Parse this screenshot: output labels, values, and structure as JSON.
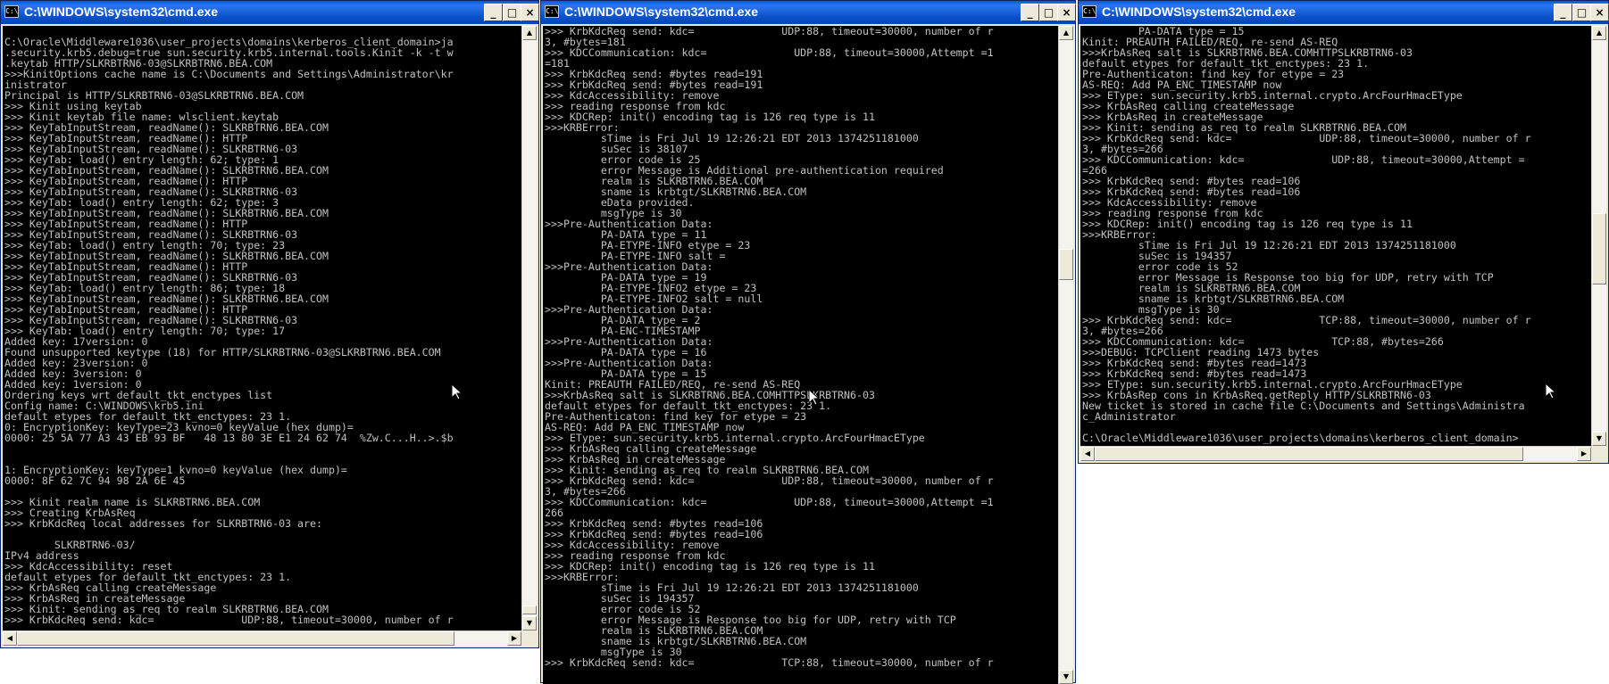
{
  "icon_names": [
    "cmd-icon",
    "minimize-icon",
    "maximize-icon",
    "close-icon",
    "scroll-up-icon",
    "scroll-down-icon",
    "scroll-left-icon",
    "scroll-right-icon",
    "mouse-cursor-icon"
  ],
  "colors": {
    "console_bg": "#000000",
    "console_fg": "#c0c0c0",
    "titlebar": "#0a58d8"
  },
  "windows": [
    {
      "title": "C:\\WINDOWS\\system32\\cmd.exe",
      "console_text": "\nC:\\Oracle\\Middleware1036\\user_projects\\domains\\kerberos_client_domain>ja\n.security.krb5.debug=true sun.security.krb5.internal.tools.Kinit -k -t w\n.keytab HTTP/SLKRBTRN6-03@SLKRBTRN6.BEA.COM\n>>>KinitOptions cache name is C:\\Documents and Settings\\Administrator\\kr\ninistrator\nPrincipal is HTTP/SLKRBTRN6-03@SLKRBTRN6.BEA.COM\n>>> Kinit using keytab\n>>> Kinit keytab file name: wlsclient.keytab\n>>> KeyTabInputStream, readName(): SLKRBTRN6.BEA.COM\n>>> KeyTabInputStream, readName(): HTTP\n>>> KeyTabInputStream, readName(): SLKRBTRN6-03\n>>> KeyTab: load() entry length: 62; type: 1\n>>> KeyTabInputStream, readName(): SLKRBTRN6.BEA.COM\n>>> KeyTabInputStream, readName(): HTTP\n>>> KeyTabInputStream, readName(): SLKRBTRN6-03\n>>> KeyTab: load() entry length: 62; type: 3\n>>> KeyTabInputStream, readName(): SLKRBTRN6.BEA.COM\n>>> KeyTabInputStream, readName(): HTTP\n>>> KeyTabInputStream, readName(): SLKRBTRN6-03\n>>> KeyTab: load() entry length: 70; type: 23\n>>> KeyTabInputStream, readName(): SLKRBTRN6.BEA.COM\n>>> KeyTabInputStream, readName(): HTTP\n>>> KeyTabInputStream, readName(): SLKRBTRN6-03\n>>> KeyTab: load() entry length: 86; type: 18\n>>> KeyTabInputStream, readName(): SLKRBTRN6.BEA.COM\n>>> KeyTabInputStream, readName(): HTTP\n>>> KeyTabInputStream, readName(): SLKRBTRN6-03\n>>> KeyTab: load() entry length: 70; type: 17\nAdded key: 17version: 0\nFound unsupported keytype (18) for HTTP/SLKRBTRN6-03@SLKRBTRN6.BEA.COM\nAdded key: 23version: 0\nAdded key: 3version: 0\nAdded key: 1version: 0\nOrdering keys wrt default_tkt_enctypes list\nConfig name: C:\\WINDOWS\\krb5.ini\ndefault etypes for default_tkt_enctypes: 23 1.\n0: EncryptionKey: keyType=23 kvno=0 keyValue (hex dump)=\n0000: 25 5A 77 A3 43 EB 93 BF   48 13 80 3E E1 24 62 74  %Zw.C...H..>.$b\n\n\n1: EncryptionKey: keyType=1 kvno=0 keyValue (hex dump)=\n0000: 8F 62 7C 94 98 2A 6E 45\n\n>>> Kinit realm name is SLKRBTRN6.BEA.COM\n>>> Creating KrbAsReq\n>>> KrbKdcReq local addresses for SLKRBTRN6-03 are:\n\n        SLKRBTRN6-03/\nIPv4 address\n>>> KdcAccessibility: reset\ndefault etypes for default_tkt_enctypes: 23 1.\n>>> KrbAsReq calling createMessage\n>>> KrbAsReq in createMessage\n>>> Kinit: sending as_req to realm SLKRBTRN6.BEA.COM\n>>> KrbKdcReq send: kdc=              UDP:88, timeout=30000, number of r"
    },
    {
      "title": "C:\\WINDOWS\\system32\\cmd.exe",
      "console_text": ">>> KrbKdcReq send: kdc=              UDP:88, timeout=30000, number of r\n3, #bytes=181\n>>> KDCCommunication: kdc=              UDP:88, timeout=30000,Attempt =1\n=181\n>>> KrbKdcReq send: #bytes read=191\n>>> KrbKdcReq send: #bytes read=191\n>>> KdcAccessibility: remove\n>>> reading response from kdc\n>>> KDCRep: init() encoding tag is 126 req type is 11\n>>>KRBError:\n         sTime is Fri Jul 19 12:26:21 EDT 2013 1374251181000\n         suSec is 38107\n         error code is 25\n         error Message is Additional pre-authentication required\n         realm is SLKRBTRN6.BEA.COM\n         sname is krbtgt/SLKRBTRN6.BEA.COM\n         eData provided.\n         msgType is 30\n>>>Pre-Authentication Data:\n         PA-DATA type = 11\n         PA-ETYPE-INFO etype = 23\n         PA-ETYPE-INFO salt =\n>>>Pre-Authentication Data:\n         PA-DATA type = 19\n         PA-ETYPE-INFO2 etype = 23\n         PA-ETYPE-INFO2 salt = null\n>>>Pre-Authentication Data:\n         PA-DATA type = 2\n         PA-ENC-TIMESTAMP\n>>>Pre-Authentication Data:\n         PA-DATA type = 16\n>>>Pre-Authentication Data:\n         PA-DATA type = 15\nKinit: PREAUTH FAILED/REQ, re-send AS-REQ\n>>>KrbAsReq salt is SLKRBTRN6.BEA.COMHTTPSLKRBTRN6-03\ndefault etypes for default_tkt_enctypes: 23 1.\nPre-Authenticaton: find key for etype = 23\nAS-REQ: Add PA_ENC_TIMESTAMP now\n>>> EType: sun.security.krb5.internal.crypto.ArcFourHmacEType\n>>> KrbAsReq calling createMessage\n>>> KrbAsReq in createMessage\n>>> Kinit: sending as_req to realm SLKRBTRN6.BEA.COM\n>>> KrbKdcReq send: kdc=              UDP:88, timeout=30000, number of r\n3, #bytes=266\n>>> KDCCommunication: kdc=              UDP:88, timeout=30000,Attempt =1\n266\n>>> KrbKdcReq send: #bytes read=106\n>>> KrbKdcReq send: #bytes read=106\n>>> KdcAccessibility: remove\n>>> reading response from kdc\n>>> KDCRep: init() encoding tag is 126 req type is 11\n>>>KRBError:\n         sTime is Fri Jul 19 12:26:21 EDT 2013 1374251181000\n         suSec is 194357\n         error code is 52\n         error Message is Response too big for UDP, retry with TCP\n         realm is SLKRBTRN6.BEA.COM\n         sname is krbtgt/SLKRBTRN6.BEA.COM\n         msgType is 30\n>>> KrbKdcReq send: kdc=              TCP:88, timeout=30000, number of r"
    },
    {
      "title": "C:\\WINDOWS\\system32\\cmd.exe",
      "console_text": "         PA-DATA type = 15\nKinit: PREAUTH FAILED/REQ, re-send AS-REQ\n>>>KrbAsReq salt is SLKRBTRN6.BEA.COMHTTPSLKRBTRN6-03\ndefault etypes for default_tkt_enctypes: 23 1.\nPre-Authenticaton: find key for etype = 23\nAS-REQ: Add PA_ENC_TIMESTAMP now\n>>> EType: sun.security.krb5.internal.crypto.ArcFourHmacEType\n>>> KrbAsReq calling createMessage\n>>> KrbAsReq in createMessage\n>>> Kinit: sending as_req to realm SLKRBTRN6.BEA.COM\n>>> KrbKdcReq send: kdc=              UDP:88, timeout=30000, number of r\n3, #bytes=266\n>>> KDCCommunication: kdc=              UDP:88, timeout=30000,Attempt =\n=266\n>>> KrbKdcReq send: #bytes read=106\n>>> KrbKdcReq send: #bytes read=106\n>>> KdcAccessibility: remove\n>>> reading response from kdc\n>>> KDCRep: init() encoding tag is 126 req type is 11\n>>>KRBError:\n         sTime is Fri Jul 19 12:26:21 EDT 2013 1374251181000\n         suSec is 194357\n         error code is 52\n         error Message is Response too big for UDP, retry with TCP\n         realm is SLKRBTRN6.BEA.COM\n         sname is krbtgt/SLKRBTRN6.BEA.COM\n         msgType is 30\n>>> KrbKdcReq send: kdc=              TCP:88, timeout=30000, number of r\n3, #bytes=266\n>>> KDCCommunication: kdc=              TCP:88, #bytes=266\n>>>DEBUG: TCPClient reading 1473 bytes\n>>> KrbKdcReq send: #bytes read=1473\n>>> KrbKdcReq send: #bytes read=1473\n>>> EType: sun.security.krb5.internal.crypto.ArcFourHmacEType\n>>> KrbAsRep cons in KrbAsReq.getReply HTTP/SLKRBTRN6-03\nNew ticket is stored in cache file C:\\Documents and Settings\\Administra\nc_Administrator\n\nC:\\Oracle\\Middleware1036\\user_projects\\domains\\kerberos_client_domain>"
    }
  ]
}
